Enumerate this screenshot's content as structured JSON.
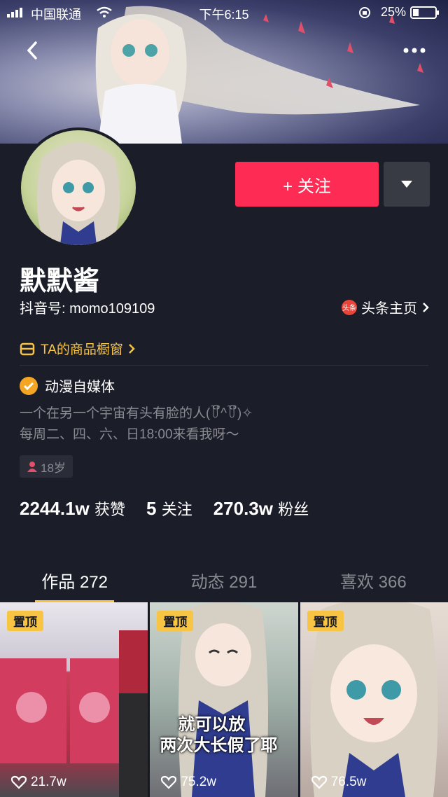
{
  "status_bar": {
    "carrier": "中国联通",
    "time": "下午6:15",
    "battery": "25%"
  },
  "profile": {
    "follow_label": "+ 关注",
    "name": "默默酱",
    "douyin_id": "抖音号: momo109109",
    "toutiao_label": "头条主页",
    "toutiao_logo": "头条",
    "shop_label": "TA的商品橱窗",
    "verified_label": "动漫自媒体",
    "bio_line1": "一个在另一个宇宙有头有脸的人(꒦ິ^꒦ິ)✧",
    "bio_line2": "每周二、四、六、日18:00来看我呀～",
    "age": "18岁"
  },
  "stats": {
    "likes_num": "2244.1w",
    "likes_label": "获赞",
    "following_num": "5",
    "following_label": "关注",
    "followers_num": "270.3w",
    "followers_label": "粉丝"
  },
  "tabs": [
    {
      "label": "作品 272"
    },
    {
      "label": "动态 291"
    },
    {
      "label": "喜欢 366"
    }
  ],
  "videos": [
    {
      "pin": "置顶",
      "likes": "21.7w"
    },
    {
      "pin": "置顶",
      "likes": "75.2w",
      "caption_line1": "就可以放",
      "caption_line2": "两次大长假了耶"
    },
    {
      "pin": "置顶",
      "likes": "76.5w"
    }
  ],
  "colors": {
    "accent": "#fe2c55",
    "gold": "#f7c443",
    "background": "#1b1d29"
  },
  "icons": [
    "signal-icon",
    "wifi-icon",
    "battery-icon",
    "back-icon",
    "more-icon",
    "chevron-down-icon",
    "shop-icon",
    "verified-icon",
    "gender-icon",
    "heart-icon"
  ]
}
